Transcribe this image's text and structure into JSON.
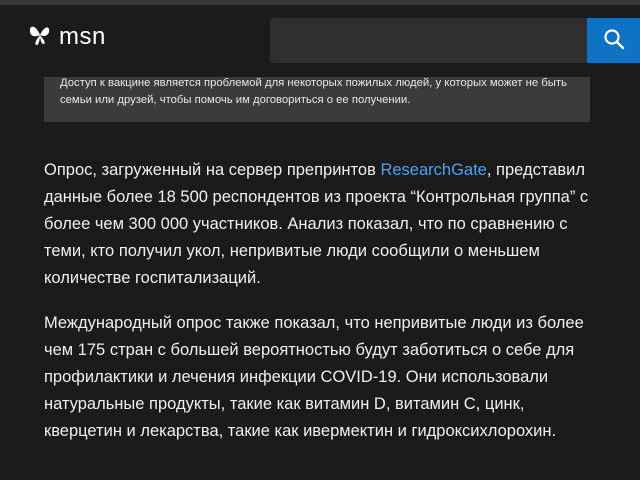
{
  "header": {
    "logo_text": "msn",
    "search": {
      "value": "",
      "placeholder": ""
    }
  },
  "callout": {
    "text": "Доступ к вакцине является проблемой для некоторых пожилых людей, у которых может не быть семьи или друзей, чтобы помочь им договориться о ее получении."
  },
  "article": {
    "p1_before_link": "Опрос, загруженный на сервер препринтов ",
    "p1_link": "ResearchGate",
    "p1_after_link": ", представил данные более 18 500 респондентов из проекта “Контрольная группа” с более чем 300 000 участников. Анализ показал, что по сравнению с теми, кто получил укол, непривитые люди сообщили о меньшем количестве госпитализаций.",
    "p2": "Международный опрос также показал, что непривитые люди из более чем 175 стран с большей вероятностью будут заботиться о себе для профилактики и лечения инфекции COVID-19. Они использовали натуральные продукты, такие как витамин D, витамин C, цинк, кверцетин и лекарства, такие как ивермектин и гидроксихлорохин."
  },
  "icons": {
    "logo": "msn-butterfly-icon",
    "search": "search-icon"
  },
  "colors": {
    "background": "#1b1b1b",
    "search_button": "#0e72c5",
    "link": "#4ea2f2",
    "callout_bg": "#3b3b3b"
  }
}
